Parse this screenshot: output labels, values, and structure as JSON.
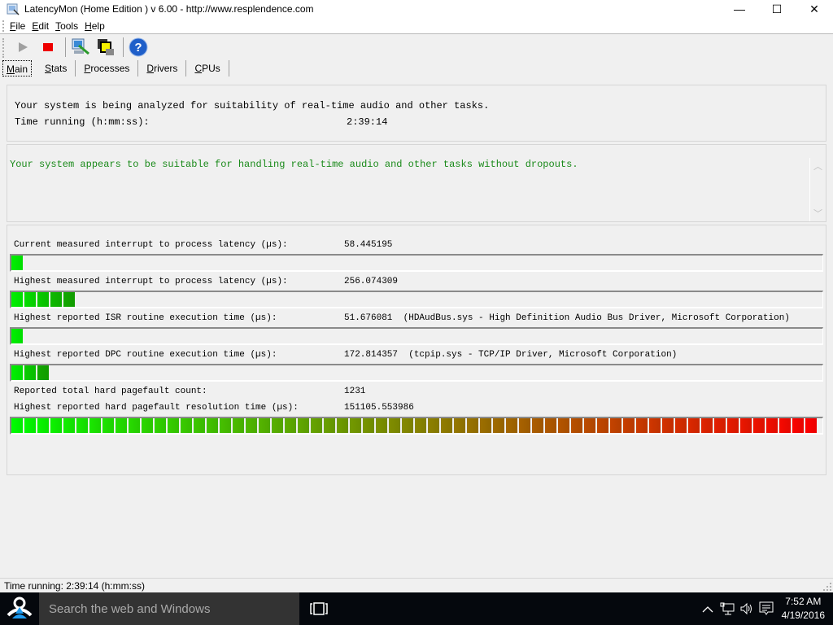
{
  "window": {
    "title": "LatencyMon  (Home Edition )  v 6.00 - http://www.resplendence.com",
    "controls": {
      "minimize": "—",
      "maximize": "☐",
      "close": "✕"
    }
  },
  "menu": [
    {
      "label": "File",
      "accel": "F",
      "rest": "ile"
    },
    {
      "label": "Edit",
      "accel": "E",
      "rest": "dit"
    },
    {
      "label": "Tools",
      "accel": "T",
      "rest": "ools"
    },
    {
      "label": "Help",
      "accel": "H",
      "rest": "elp"
    }
  ],
  "toolbar": {
    "buttons": [
      "start-monitor",
      "stop-monitor",
      "connect-remote",
      "windows-view",
      "help"
    ]
  },
  "tabs": [
    {
      "label": "Main",
      "accel": "M",
      "rest": "ain",
      "active": true
    },
    {
      "label": "Stats",
      "accel": "S",
      "rest": "tats",
      "active": false
    },
    {
      "label": "Processes",
      "accel": "P",
      "rest": "rocesses",
      "active": false
    },
    {
      "label": "Drivers",
      "accel": "D",
      "rest": "rivers",
      "active": false
    },
    {
      "label": "CPUs",
      "accel": "C",
      "rest": "PUs",
      "active": false
    }
  ],
  "info": {
    "line1": "Your system is being analyzed for suitability of real-time audio and other tasks.",
    "time_label": "Time running (h:mm:ss):",
    "time_value": "2:39:14"
  },
  "message": {
    "text": "Your system appears to be suitable for handling real-time audio and other tasks without dropouts.",
    "color": "#1a8a1a"
  },
  "stats": [
    {
      "label": "Current measured interrupt to process latency (µs):",
      "value": "58.445195",
      "detail": "",
      "bar_segments": 1
    },
    {
      "label": "Highest measured interrupt to process latency (µs):",
      "value": "256.074309",
      "detail": "",
      "bar_segments": 5
    },
    {
      "label": "Highest reported ISR routine execution time (µs):",
      "value": "51.676081",
      "detail": "(HDAudBus.sys - High Definition Audio Bus Driver, Microsoft Corporation)",
      "bar_segments": 1
    },
    {
      "label": "Highest reported DPC routine execution time (µs):",
      "value": "172.814357",
      "detail": "(tcpip.sys - TCP/IP Driver, Microsoft Corporation)",
      "bar_segments": 3
    },
    {
      "label": "Reported total hard pagefault count:",
      "value": "1231",
      "detail": ""
    },
    {
      "label": "Highest reported hard pagefault resolution time (µs):",
      "value": "151105.553986",
      "detail": "",
      "bar_segments": 62
    }
  ],
  "bar_total_segments": 62,
  "bar_colors": {
    "start": "#00ff00",
    "mid": "#888800",
    "end": "#ff0000"
  },
  "statusbar": {
    "text": "Time running: 2:39:14  (h:mm:ss)"
  },
  "taskbar": {
    "search_placeholder": "Search the web and Windows",
    "time": "7:52 AM",
    "date": "4/19/2016"
  }
}
